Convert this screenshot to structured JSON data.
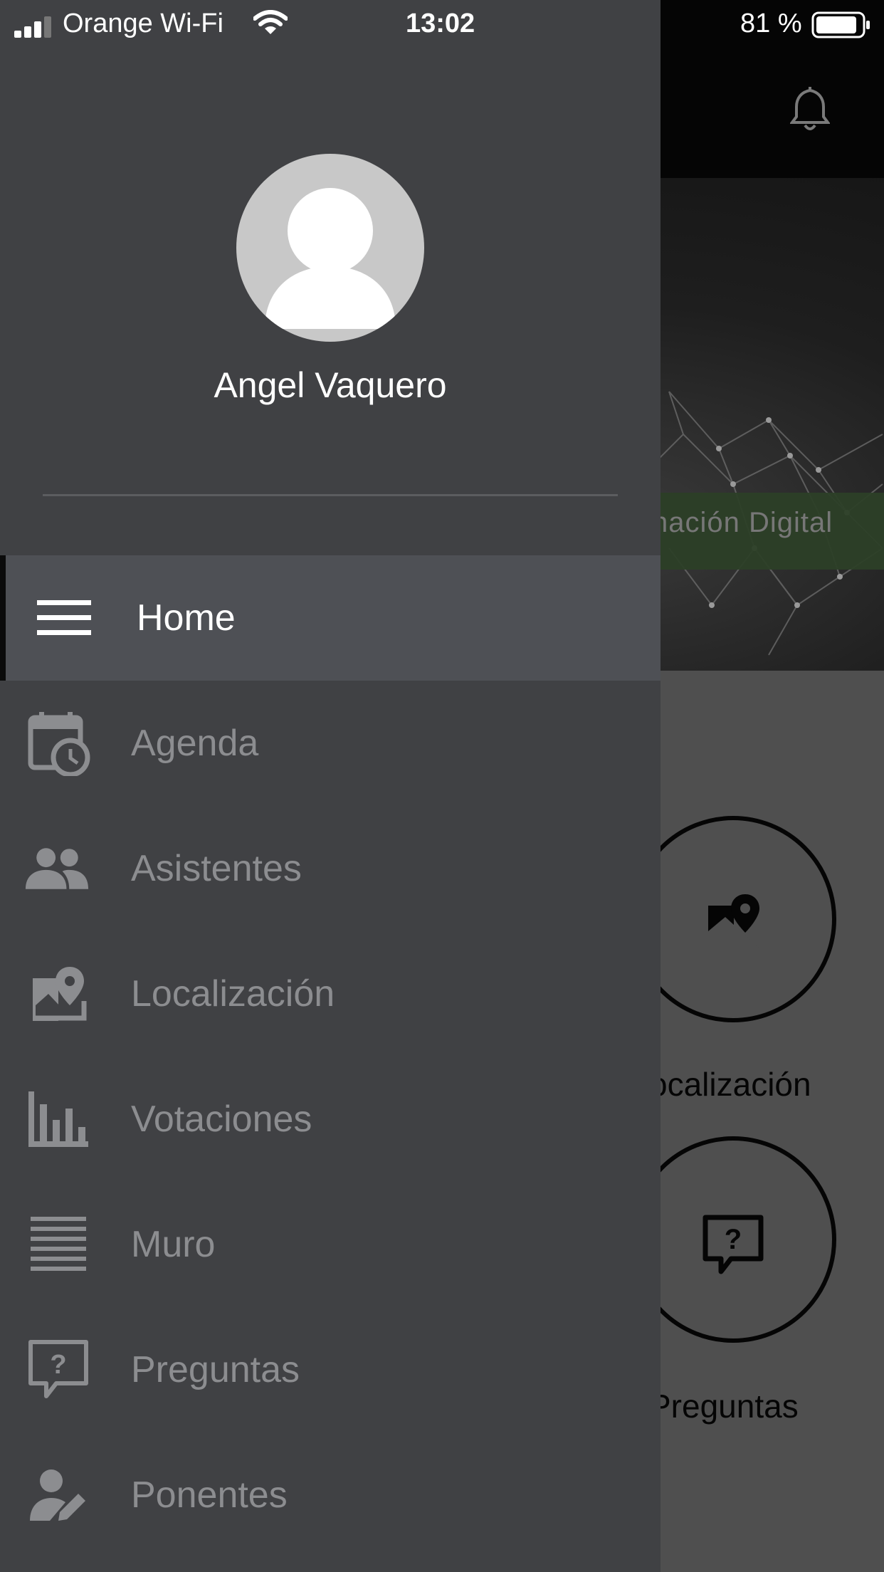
{
  "status_bar": {
    "carrier": "Orange Wi-Fi",
    "time": "13:02",
    "battery_percent": "81 %"
  },
  "background": {
    "banner_text": "nación Digital",
    "tiles": [
      {
        "label": "ocalización",
        "icon": "map-pin-icon"
      },
      {
        "label": "Preguntas",
        "icon": "question-bubble-icon"
      }
    ]
  },
  "drawer": {
    "user_name": "Angel Vaquero",
    "menu": [
      {
        "label": "Home",
        "icon": "hamburger-icon",
        "active": true
      },
      {
        "label": "Agenda",
        "icon": "calendar-clock-icon",
        "active": false
      },
      {
        "label": "Asistentes",
        "icon": "people-icon",
        "active": false
      },
      {
        "label": "Localización",
        "icon": "map-pin-icon",
        "active": false
      },
      {
        "label": "Votaciones",
        "icon": "bar-chart-icon",
        "active": false
      },
      {
        "label": "Muro",
        "icon": "lines-icon",
        "active": false
      },
      {
        "label": "Preguntas",
        "icon": "question-bubble-icon",
        "active": false
      },
      {
        "label": "Ponentes",
        "icon": "person-edit-icon",
        "active": false
      }
    ]
  },
  "colors": {
    "drawer_bg": "#404144",
    "active_item_bg": "#4e5055",
    "inactive_text": "#8c8d90",
    "active_text": "#ffffff"
  }
}
